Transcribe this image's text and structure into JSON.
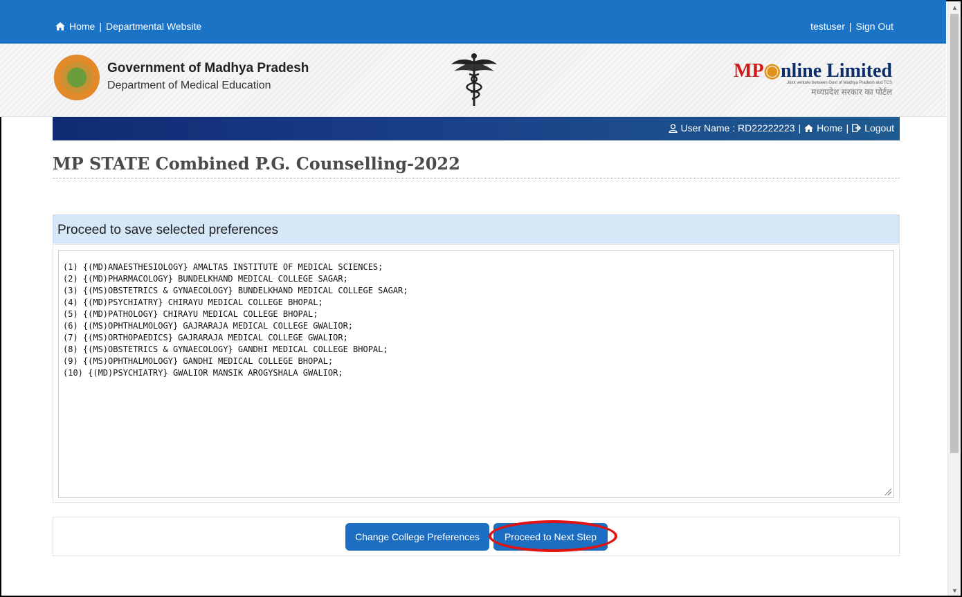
{
  "topbar": {
    "home_icon": "home-icon",
    "home_label": "Home",
    "separator": "|",
    "dept_website_label": "Departmental Website",
    "user_label": "testuser",
    "signout_label": "Sign Out"
  },
  "banner": {
    "gov_title": "Government of Madhya Pradesh",
    "gov_subtitle": "Department of Medical Education",
    "mpo_brand_mp": "MP",
    "mpo_brand_rest": "nline Limited",
    "mpo_tagline": "Joint venture between Govt of Madhya Pradesh and TCS",
    "mpo_hindi": "मध्यप्रदेश सरकार का पोर्टल"
  },
  "navbar": {
    "user_prefix": "User Name : RD22222223",
    "separator": "|",
    "home_label": "Home",
    "logout_label": "Logout"
  },
  "page": {
    "title": "MP STATE Combined P.G. Counselling-2022"
  },
  "panel": {
    "heading": "Proceed to save selected preferences",
    "preferences": [
      "(1) {(MD)ANAESTHESIOLOGY} AMALTAS INSTITUTE OF MEDICAL SCIENCES;",
      "(2) {(MD)PHARMACOLOGY} BUNDELKHAND MEDICAL COLLEGE SAGAR;",
      "(3) {(MS)OBSTETRICS & GYNAECOLOGY} BUNDELKHAND MEDICAL COLLEGE SAGAR;",
      "(4) {(MD)PSYCHIATRY} CHIRAYU MEDICAL COLLEGE BHOPAL;",
      "(5) {(MD)PATHOLOGY} CHIRAYU MEDICAL COLLEGE BHOPAL;",
      "(6) {(MS)OPHTHALMOLOGY} GAJRARAJA MEDICAL COLLEGE GWALIOR;",
      "(7) {(MS)ORTHOPAEDICS} GAJRARAJA MEDICAL COLLEGE GWALIOR;",
      "(8) {(MS)OBSTETRICS & GYNAECOLOGY} GANDHI MEDICAL COLLEGE BHOPAL;",
      "(9) {(MS)OPHTHALMOLOGY} GANDHI MEDICAL COLLEGE BHOPAL;",
      "(10) {(MD)PSYCHIATRY} GWALIOR MANSIK AROGYSHALA GWALIOR;"
    ]
  },
  "buttons": {
    "change_label": "Change College Preferences",
    "proceed_label": "Proceed to Next Step"
  },
  "colors": {
    "topbar": "#1a73c4",
    "button": "#1b6ec2",
    "highlight": "#e01212",
    "panel_head": "#d6e8f8"
  }
}
